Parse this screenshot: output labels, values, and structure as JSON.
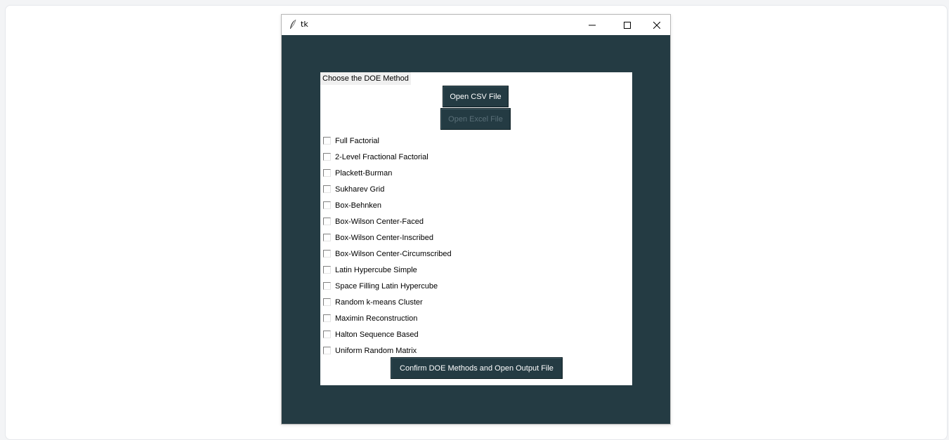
{
  "window": {
    "title": "tk",
    "controls": [
      "minimize",
      "maximize",
      "close"
    ]
  },
  "panel": {
    "label": "Choose the DOE Method"
  },
  "buttons": {
    "open_csv": "Open CSV File",
    "open_excel": "Open Excel File",
    "confirm": "Confirm DOE Methods and Open Output File"
  },
  "methods": [
    {
      "label": "Full Factorial",
      "checked": false
    },
    {
      "label": "2-Level Fractional Factorial",
      "checked": false
    },
    {
      "label": "Plackett-Burman",
      "checked": false
    },
    {
      "label": "Sukharev Grid",
      "checked": false
    },
    {
      "label": "Box-Behnken",
      "checked": false
    },
    {
      "label": "Box-Wilson Center-Faced",
      "checked": false
    },
    {
      "label": "Box-Wilson Center-Inscribed",
      "checked": false
    },
    {
      "label": "Box-Wilson Center-Circumscribed",
      "checked": false
    },
    {
      "label": "Latin Hypercube Simple",
      "checked": false
    },
    {
      "label": "Space Filling Latin Hypercube",
      "checked": false
    },
    {
      "label": "Random k-means Cluster",
      "checked": false
    },
    {
      "label": "Maximin Reconstruction",
      "checked": false
    },
    {
      "label": "Halton Sequence Based",
      "checked": false
    },
    {
      "label": "Uniform Random Matrix",
      "checked": false
    }
  ],
  "colors": {
    "background": "#243b43",
    "button": "#243b43",
    "button_text": "#ffffff",
    "button_disabled_text": "#5b7079"
  },
  "icons": {
    "app": "feather-icon",
    "minimize": "minimize-icon",
    "maximize": "maximize-icon",
    "close": "close-icon"
  }
}
